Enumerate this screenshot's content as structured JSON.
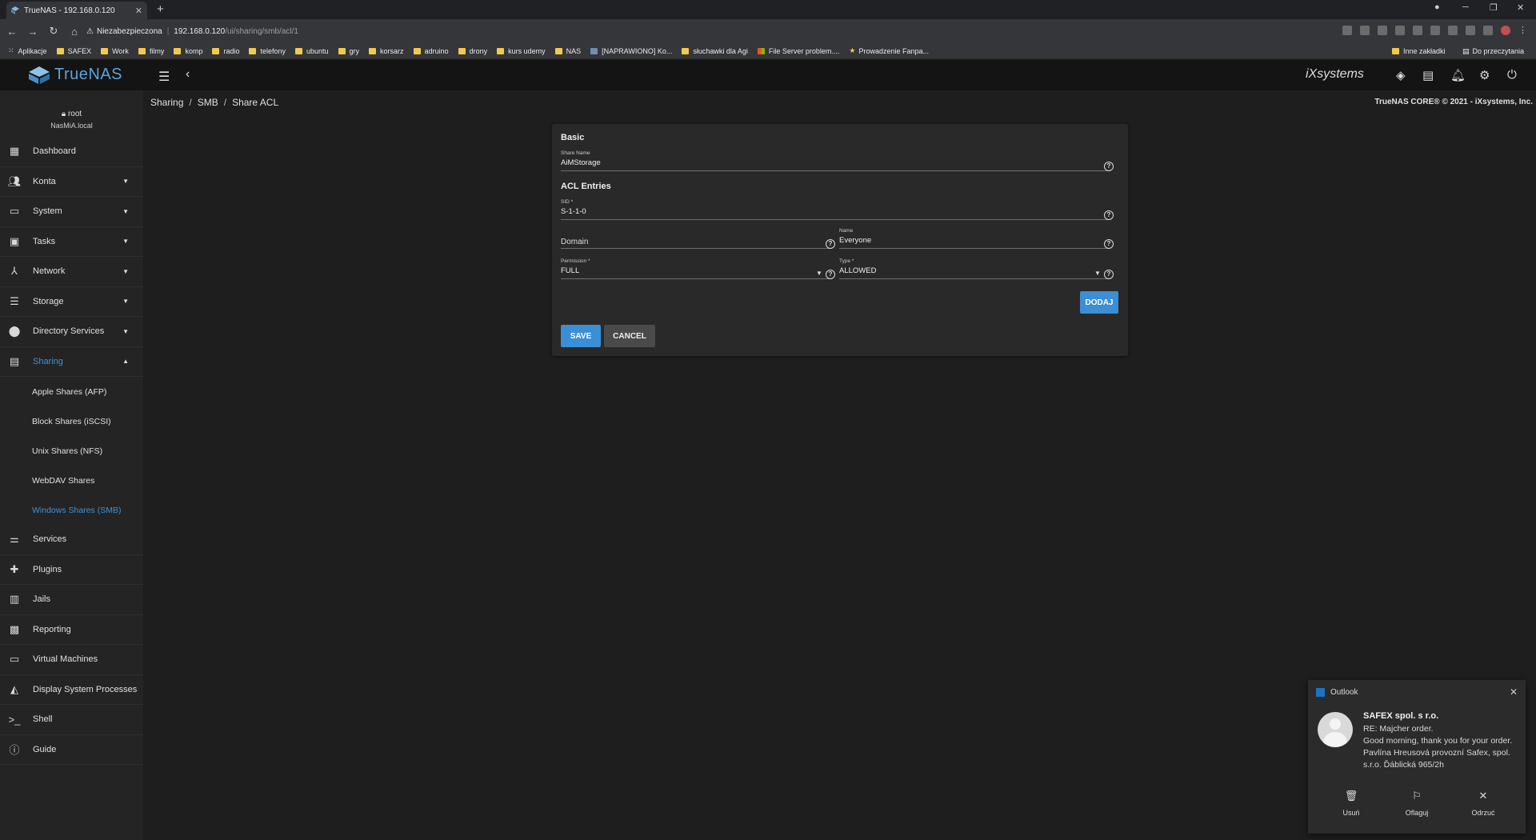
{
  "browser": {
    "tab_title": "TrueNAS - 192.168.0.120",
    "tab_close": "✕",
    "new_tab": "+",
    "security_label": "Niezabezpieczona",
    "url_host": "192.168.0.120",
    "url_path": "/ui/sharing/smb/acl/1",
    "bookmarks": [
      "Aplikacje",
      "SAFEX",
      "Work",
      "filmy",
      "komp",
      "radio",
      "telefony",
      "ubuntu",
      "gry",
      "korsarz",
      "adruino",
      "drony",
      "kurs udemy",
      "NAS",
      "[NAPRAWIONO] Ko...",
      "słuchawki dla Agi",
      "File Server problem....",
      "Prowadzenie Fanpa..."
    ],
    "bookmarks_other": "Inne zakładki",
    "reading_list": "Do przeczytania"
  },
  "app": {
    "brand": "TrueNAS",
    "vendor": "iXsystems",
    "copyright": "TrueNAS CORE® © 2021 - iXsystems, Inc."
  },
  "breadcrumb": [
    "Sharing",
    "SMB",
    "Share ACL"
  ],
  "user": {
    "name": "root",
    "host": "NasMiA.local"
  },
  "sidebar": {
    "items": [
      {
        "label": "Dashboard",
        "icon": "dashboard-icon"
      },
      {
        "label": "Konta",
        "icon": "accounts-icon"
      },
      {
        "label": "System",
        "icon": "system-icon"
      },
      {
        "label": "Tasks",
        "icon": "tasks-icon"
      },
      {
        "label": "Network",
        "icon": "network-icon"
      },
      {
        "label": "Storage",
        "icon": "storage-icon"
      },
      {
        "label": "Directory Services",
        "icon": "directory-icon"
      },
      {
        "label": "Sharing",
        "icon": "sharing-icon"
      },
      {
        "label": "Services",
        "icon": "services-icon"
      },
      {
        "label": "Plugins",
        "icon": "plugins-icon"
      },
      {
        "label": "Jails",
        "icon": "jails-icon"
      },
      {
        "label": "Reporting",
        "icon": "reporting-icon"
      },
      {
        "label": "Virtual Machines",
        "icon": "vm-icon"
      },
      {
        "label": "Display System Processes",
        "icon": "processes-icon"
      },
      {
        "label": "Shell",
        "icon": "shell-icon"
      },
      {
        "label": "Guide",
        "icon": "guide-icon"
      }
    ],
    "sharing_sub": [
      "Apple Shares (AFP)",
      "Block Shares (iSCSI)",
      "Unix Shares (NFS)",
      "WebDAV Shares",
      "Windows Shares (SMB)"
    ],
    "active_color": "#3f93d3"
  },
  "form": {
    "basic_title": "Basic",
    "share_name_label": "Share Name",
    "share_name_value": "AiMStorage",
    "acl_title": "ACL Entries",
    "sid_label": "SID *",
    "sid_value": "S-1-1-0",
    "domain_placeholder": "Domain",
    "name_label": "Name",
    "name_value": "Everyone",
    "permission_label": "Permission *",
    "permission_value": "FULL",
    "type_label": "Type *",
    "type_value": "ALLOWED",
    "add_button": "DODAJ",
    "save_button": "SAVE",
    "cancel_button": "CANCEL",
    "help_glyph": "?"
  },
  "toast": {
    "app": "Outlook",
    "from": "SAFEX spol. s r.o.",
    "body": "RE: Majcher order.\nGood morning,  thank you for your order.   Pavlína Hreusová  provozní Safex, spol. s.r.o.  Ďáblická 965/2h",
    "actions": [
      "Usuń",
      "Oflaguj",
      "Odrzuć"
    ],
    "close": "✕"
  }
}
